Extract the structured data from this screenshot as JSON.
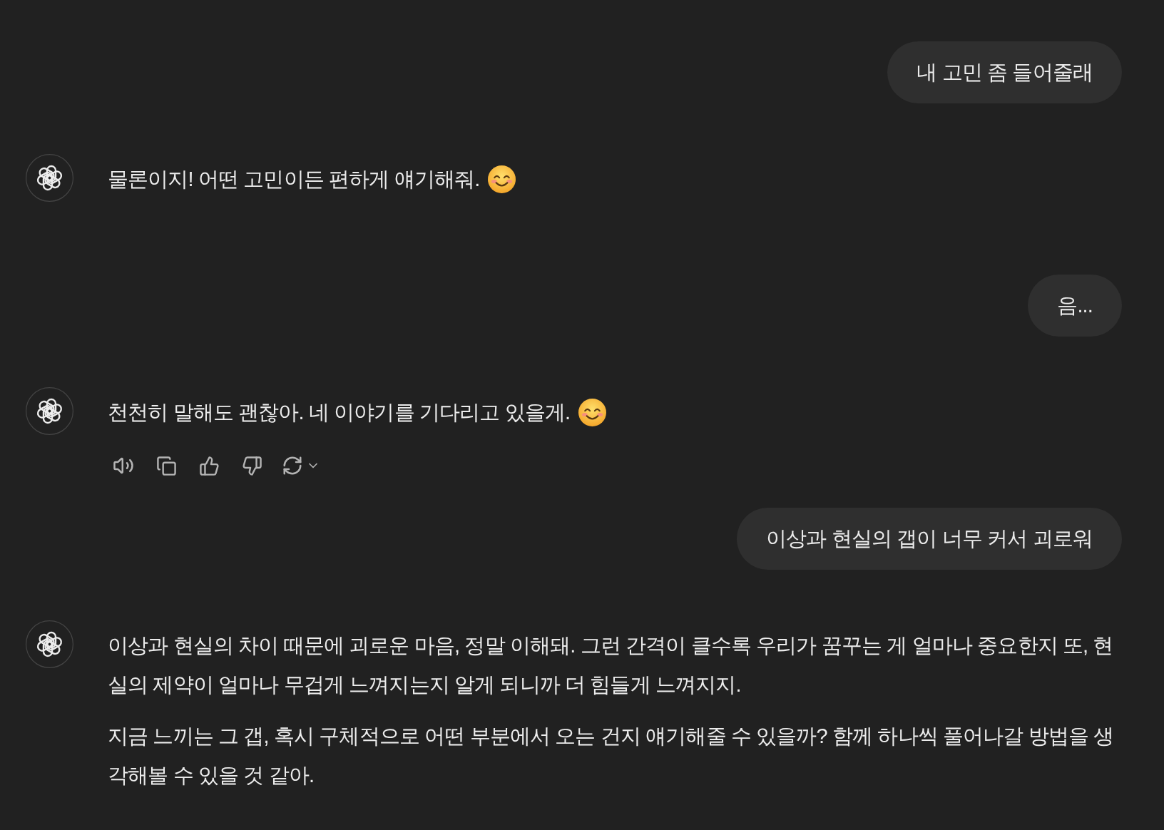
{
  "messages": [
    {
      "kind": "user",
      "text": "내 고민 좀 들어줄래"
    },
    {
      "kind": "assistant",
      "paragraphs": [
        "물론이지! 어떤 고민이든 편하게 얘기해줘."
      ],
      "emoji": true,
      "action_bar": false
    },
    {
      "kind": "user",
      "text": "음..."
    },
    {
      "kind": "assistant",
      "paragraphs": [
        "천천히 말해도 괜찮아. 네 이야기를 기다리고 있을게."
      ],
      "emoji": true,
      "action_bar": true
    },
    {
      "kind": "user",
      "text": "이상과 현실의 갭이 너무 커서 괴로워"
    },
    {
      "kind": "assistant",
      "paragraphs": [
        "이상과 현실의 차이 때문에 괴로운 마음, 정말 이해돼. 그런 간격이 클수록 우리가 꿈꾸는 게 얼마나 중요한지 또, 현실의 제약이 얼마나 무겁게 느껴지는지 알게 되니까 더 힘들게 느껴지지.",
        "지금 느끼는 그 갭, 혹시 구체적으로 어떤 부분에서 오는 건지 얘기해줄 수 있을까? 함께 하나씩 풀어나갈 방법을 생각해볼 수 있을 것 같아."
      ],
      "emoji": false,
      "action_bar": false
    }
  ]
}
